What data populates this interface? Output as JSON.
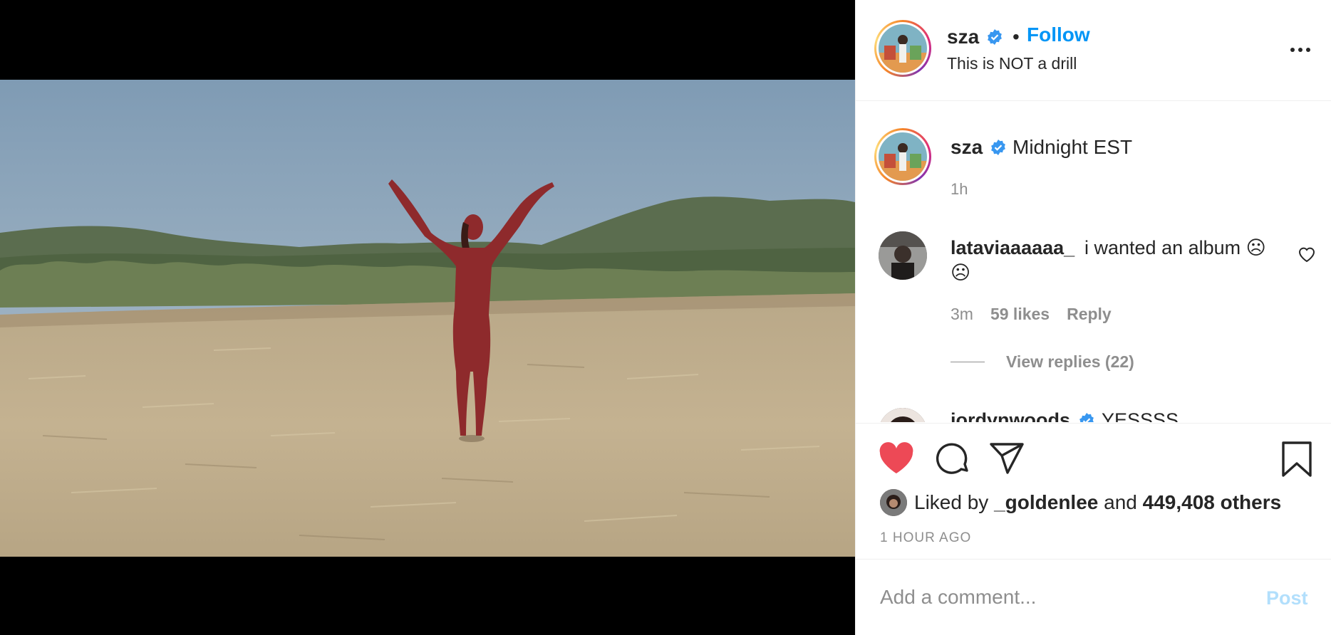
{
  "post": {
    "username": "sza",
    "follow_label": "Follow",
    "separator": "•",
    "subtitle": "This is NOT a drill",
    "more_icon": "more-horizontal-icon"
  },
  "caption": {
    "username": "sza",
    "text": "Midnight EST",
    "time": "1h"
  },
  "comments": [
    {
      "username": "lataviaaaaaa_",
      "text_line1": "i wanted an album ☹",
      "text_line2": "☹",
      "time": "3m",
      "likes": "59 likes",
      "reply_label": "Reply",
      "view_replies": "View replies (22)"
    },
    {
      "username": "jordynwoods",
      "text": "YESSSS"
    }
  ],
  "actions": {
    "liked_by_prefix": "Liked by",
    "liked_by_user": "_goldenlee",
    "liked_by_and": "and",
    "liked_by_others": "449,408 others",
    "time_ago": "1 HOUR AGO"
  },
  "add_comment": {
    "placeholder": "Add a comment...",
    "post_label": "Post"
  },
  "colors": {
    "accent": "#0095f6",
    "like_red": "#ed4956",
    "muted": "#8e8e8e",
    "post_disabled": "#b2dffc"
  }
}
